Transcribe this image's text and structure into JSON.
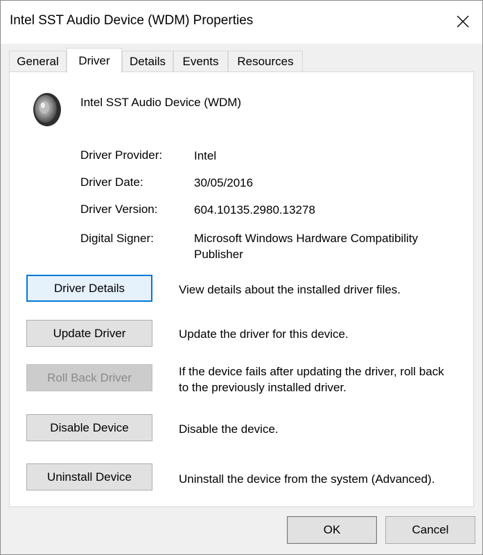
{
  "window": {
    "title": "Intel SST Audio Device (WDM) Properties"
  },
  "tabs": [
    {
      "label": "General"
    },
    {
      "label": "Driver"
    },
    {
      "label": "Details"
    },
    {
      "label": "Events"
    },
    {
      "label": "Resources"
    }
  ],
  "active_tab": "Driver",
  "device": {
    "name": "Intel SST Audio Device (WDM)",
    "icon": "speaker-icon"
  },
  "properties": {
    "provider_label": "Driver Provider:",
    "provider_value": "Intel",
    "date_label": "Driver Date:",
    "date_value": "30/05/2016",
    "version_label": "Driver Version:",
    "version_value": "604.10135.2980.13278",
    "signer_label": "Digital Signer:",
    "signer_value": "Microsoft Windows Hardware Compatibility Publisher"
  },
  "actions": {
    "details_label": "Driver Details",
    "details_desc": "View details about the installed driver files.",
    "update_label": "Update Driver",
    "update_desc": "Update the driver for this device.",
    "rollback_label": "Roll Back Driver",
    "rollback_desc": "If the device fails after updating the driver, roll back to the previously installed driver.",
    "disable_label": "Disable Device",
    "disable_desc": "Disable the device.",
    "uninstall_label": "Uninstall Device",
    "uninstall_desc": "Uninstall the device from the system (Advanced)."
  },
  "footer": {
    "ok_label": "OK",
    "cancel_label": "Cancel"
  },
  "colors": {
    "focus_accent": "#0078d7",
    "disabled_text": "#8a8a8a"
  }
}
